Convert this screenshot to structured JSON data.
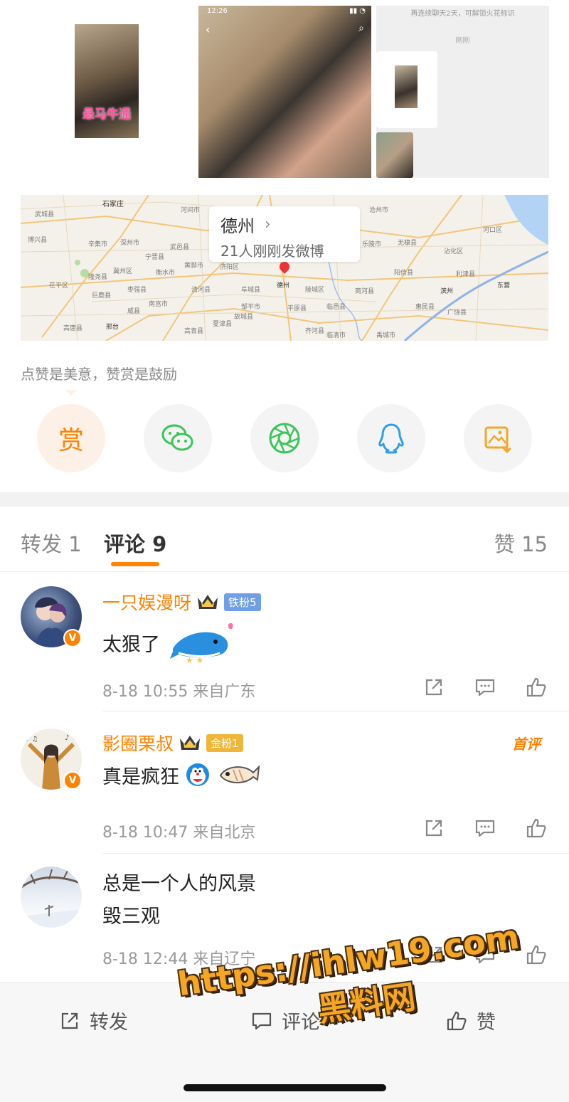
{
  "media": {
    "left_thumb_caption": "悬马牛通",
    "screenshot_time": "12:26",
    "chat_system_text": "再连续聊天2天，可解锁火花标识",
    "chat_time_text": "刚刚"
  },
  "map": {
    "city": "德州",
    "chevron": "›",
    "subtitle": "21人刚刚发微博",
    "labels": [
      "石家庄",
      "河间市",
      "沧州市",
      "黄骅市",
      "衡水市",
      "冀州区",
      "武邑县",
      "阜城县",
      "德州",
      "乐陵市",
      "无棣县",
      "沾化区",
      "河口区",
      "利津县",
      "东营",
      "滨州",
      "惠民县",
      "商河县",
      "临邑县",
      "陵城区",
      "平原县",
      "夏津县",
      "清河县",
      "南宫市",
      "威县",
      "邢台",
      "巨鹿县",
      "隆尧县",
      "宁晋县",
      "辛集市",
      "深州市",
      "枣强县",
      "故城县",
      "武城县",
      "济阳区",
      "阳信县",
      "广饶县",
      "博兴县",
      "邹平市",
      "高青县",
      "齐河县",
      "禹城市",
      "临清市",
      "高唐县",
      "茌平区"
    ]
  },
  "reward": {
    "text": "点赞是美意，赞赏是鼓励",
    "reward_char": "赏"
  },
  "share_icons": [
    "wechat-icon",
    "moments-icon",
    "qq-icon",
    "save-image-icon"
  ],
  "tabs": {
    "repost": "转发 1",
    "comments": "评论 9",
    "likes": "赞 15"
  },
  "comments": [
    {
      "name": "一只娱漫呀",
      "fan_badge": "铁粉5",
      "text": "太狠了",
      "meta": "8-18 10:55 来自广东"
    },
    {
      "name": "影圈栗叔",
      "fan_badge": "金粉1",
      "first_tag": "首评",
      "text": "真是疯狂",
      "meta": "8-18 10:47 来自北京"
    },
    {
      "name": "",
      "text_line1": "总是一个人的风景",
      "text_line2": "毁三观",
      "meta": "8-18 12:44 来自辽宁"
    }
  ],
  "badge_v": "V",
  "bottom_bar": {
    "repost": "转发",
    "comment": "评论",
    "like": "赞"
  },
  "watermark": {
    "line1": "https://ihlw19.com",
    "line2": "黑料网"
  },
  "colors": {
    "accent": "#ff8200",
    "iron_badge": "#6f9fe8",
    "gold_badge": "#f0b63a"
  }
}
